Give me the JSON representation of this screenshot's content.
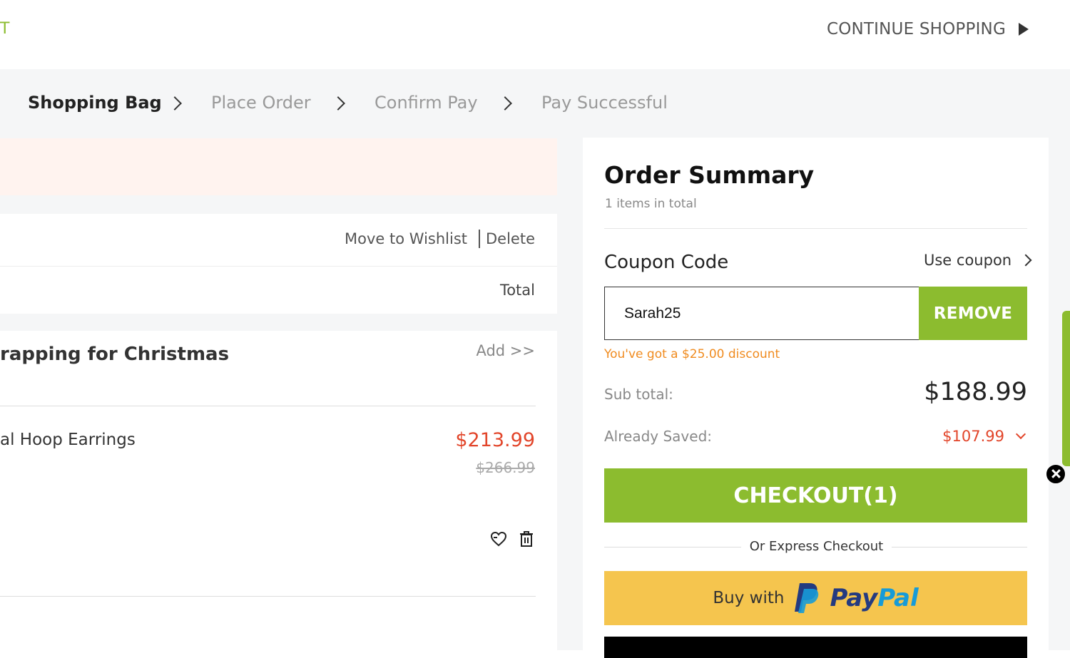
{
  "header": {
    "brand_fragment": "T",
    "continue_label": "CONTINUE SHOPPING"
  },
  "steps": [
    "Shopping Bag",
    "Place Order",
    "Confirm Pay",
    "Pay Successful"
  ],
  "bag": {
    "move_to_wishlist": "Move to Wishlist",
    "delete": "Delete",
    "total_label": "Total",
    "gift_title": "rapping for Christmas",
    "add_link": "Add >>",
    "item": {
      "name": "al Hoop Earrings",
      "price": "$213.99",
      "old_price": "$266.99"
    }
  },
  "summary": {
    "title": "Order Summary",
    "count": "1 items in total",
    "coupon_label": "Coupon Code",
    "use_coupon": "Use coupon",
    "coupon_value": "Sarah25",
    "remove_label": "REMOVE",
    "discount_msg": "You've got a $25.00 discount",
    "subtotal_label": "Sub total:",
    "subtotal_value": "$188.99",
    "saved_label": "Already Saved:",
    "saved_value": "$107.99",
    "checkout_label": "CHECKOUT(1)",
    "express_label": "Or Express Checkout",
    "paypal_buy": "Buy with",
    "paypal_word_a": "Pay",
    "paypal_word_b": "Pal"
  },
  "colors": {
    "accent_green": "#8cbc2f",
    "price_red": "#e2462b",
    "discount_orange": "#f08b1f",
    "paypal_yellow": "#f5c54e"
  }
}
